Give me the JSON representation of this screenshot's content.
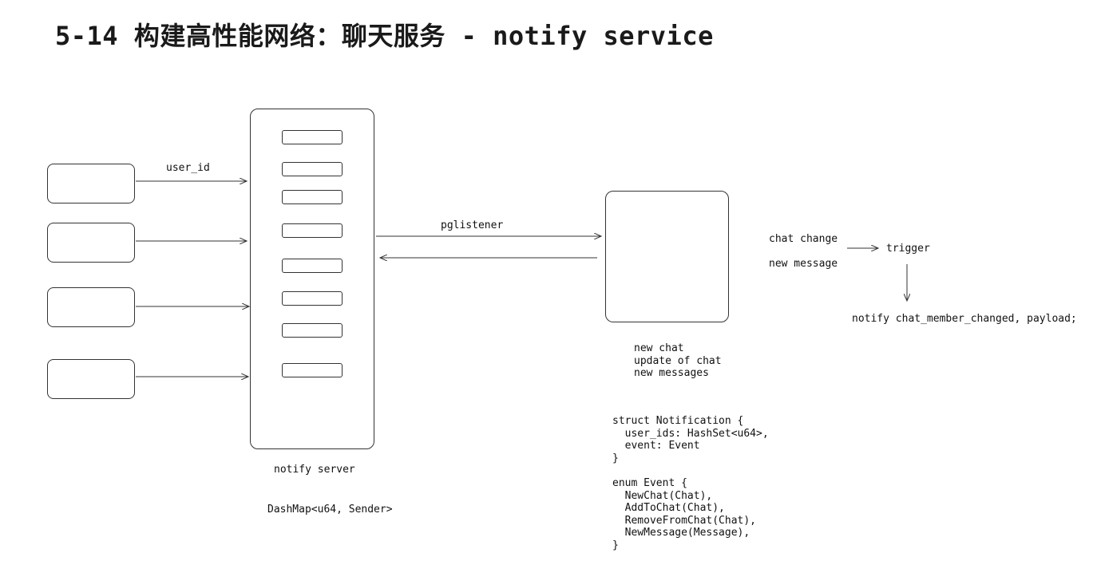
{
  "title": "5-14 构建高性能网络：聊天服务 - notify service",
  "labels": {
    "user_id": "user_id",
    "pglistener": "pglistener",
    "notify_server": "notify server",
    "dashmap": "DashMap<u64, Sender>",
    "chat_change": "chat change",
    "new_message": "new message",
    "trigger": "trigger",
    "notify_payload": "notify chat_member_changed, payload;",
    "db_events": "new chat\nupdate of chat\nnew messages",
    "struct_notification": "struct Notification {\n  user_ids: HashSet<u64>,\n  event: Event\n}",
    "enum_event": "enum Event {\n  NewChat(Chat),\n  AddToChat(Chat),\n  RemoveFromChat(Chat),\n  NewMessage(Message),\n}"
  }
}
